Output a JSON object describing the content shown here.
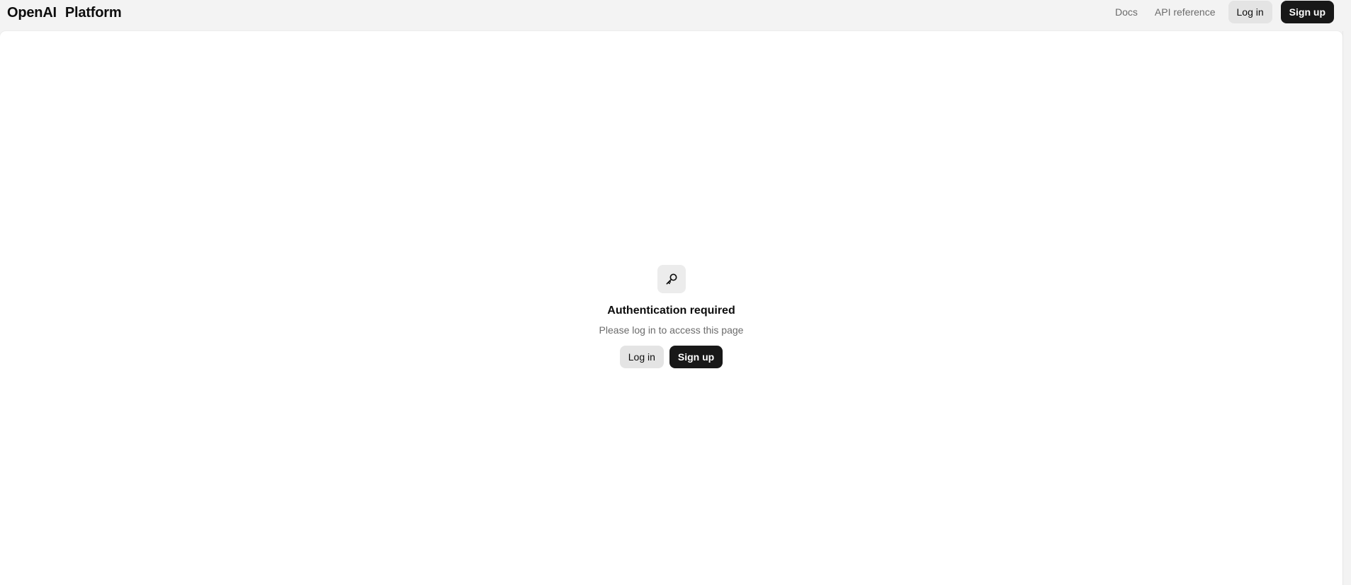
{
  "header": {
    "brand": {
      "company": "OpenAI",
      "product": "Platform"
    },
    "nav": {
      "docs_label": "Docs",
      "api_reference_label": "API reference",
      "login_label": "Log in",
      "signup_label": "Sign up"
    }
  },
  "auth": {
    "icon": "key-icon",
    "title": "Authentication required",
    "subtitle": "Please log in to access this page",
    "login_label": "Log in",
    "signup_label": "Sign up"
  },
  "colors": {
    "page_background": "#f3f3f3",
    "panel_background": "#ffffff",
    "primary_button": "#181818",
    "secondary_button": "#e4e4e4",
    "muted_text": "#6b6b6b"
  }
}
